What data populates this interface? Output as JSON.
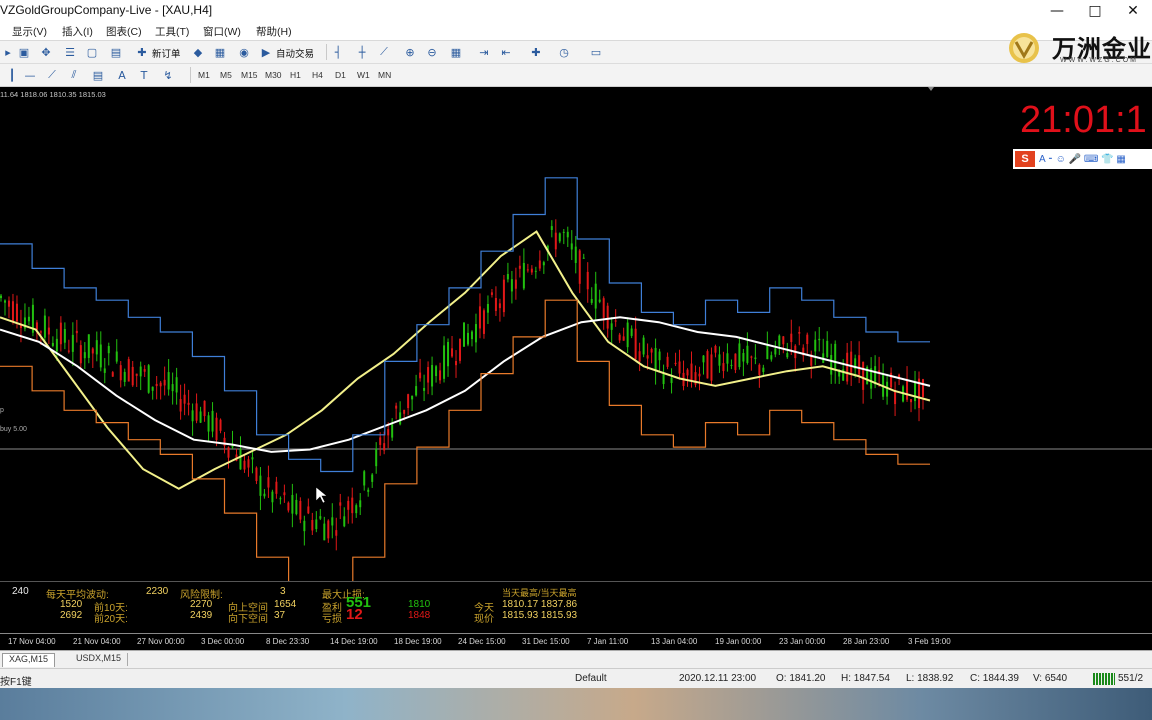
{
  "window": {
    "title": "VZGoldGroupCompany-Live - [XAU,H4]",
    "min": "—",
    "max": "□",
    "close": "✕"
  },
  "menu": [
    "显示(V)",
    "插入(I)",
    "图表(C)",
    "工具(T)",
    "窗口(W)",
    "帮助(H)"
  ],
  "toolbar": {
    "new_order": "新订单",
    "auto_trading": "自动交易"
  },
  "timeframes": [
    "M1",
    "M5",
    "M15",
    "M30",
    "H1",
    "H4",
    "D1",
    "W1",
    "MN"
  ],
  "logo": {
    "name": "万洲金业",
    "url": "WWW.WZG.COM"
  },
  "chart": {
    "ohlc_readout": "11.64 1818.06 1810.35 1815.03",
    "clock": "21:01:1",
    "side_label_p": "p",
    "side_label_buy": "buy 5.00",
    "ime_toolbar": "A ⁃ ☺ 🎤 ⌨ 👕 ▦"
  },
  "chart_data": {
    "type": "line",
    "symbol": "XAU",
    "timeframe": "H4",
    "x_ticks": [
      "17 Nov 04:00",
      "21 Nov 04:00",
      "27 Nov 00:00",
      "3 Dec 00:00",
      "8 Dec 23:30",
      "14 Dec 19:00",
      "18 Dec 19:00",
      "24 Dec 15:00",
      "31 Dec 15:00",
      "7 Jan 11:00",
      "13 Jan 04:00",
      "19 Jan 00:00",
      "23 Jan 00:00",
      "28 Jan 23:00",
      "3 Feb 19:00"
    ],
    "series": [
      {
        "values": [
          1878,
          1868,
          1860,
          1855,
          1848,
          1842,
          1832,
          1818,
          1800,
          1790,
          1785,
          1800,
          1830,
          1845,
          1860,
          1875,
          1890,
          1905,
          1880,
          1862,
          1850,
          1845,
          1855,
          1850,
          1860,
          1855,
          1848,
          1842,
          1838
        ]
      },
      {
        "values": [
          1870,
          1865,
          1845,
          1825,
          1808,
          1800,
          1808,
          1815,
          1822,
          1832,
          1845,
          1855,
          1868,
          1880,
          1895,
          1905,
          1880,
          1860,
          1850,
          1845,
          1842,
          1845,
          1848,
          1850,
          1846,
          1840,
          1836
        ]
      },
      {
        "values": [
          1865,
          1860,
          1850,
          1838,
          1828,
          1820,
          1818,
          1815,
          1816,
          1820,
          1826,
          1832,
          1840,
          1852,
          1862,
          1868,
          1870,
          1868,
          1864,
          1862,
          1858,
          1854,
          1850,
          1846,
          1842
        ]
      }
    ]
  },
  "info_panel": {
    "v240": "240",
    "lbl_daily": "每天平均波动:",
    "v2230": "2230",
    "lbl_risk": "风险限制:",
    "v3": "3",
    "lbl_max": "最大止损:",
    "lbl_lastday": "当天最高/当天最高",
    "v1520": "1520",
    "lbl_10d": "前10天:",
    "v2270": "2270",
    "lbl_up": "向上空间",
    "v1654": "1654",
    "lbl_win": "盈利",
    "v551": "551",
    "v1810": "1810",
    "lbl_today": "今天",
    "today_vals": "1810.17 1837.86",
    "v2692": "2692",
    "lbl_20d": "前20天:",
    "v2439": "2439",
    "lbl_down": "向下空间",
    "v37": "37",
    "lbl_loss": "亏损",
    "v12": "12",
    "v1848": "1848",
    "lbl_now": "现价",
    "now_vals": "1815.93 1815.93"
  },
  "tabs": [
    "XAG,M15",
    "USDX,M15"
  ],
  "status": {
    "help": "按F1键",
    "profile": "Default",
    "datetime": "2020.12.11 23:00",
    "open": "O: 1841.20",
    "high": "H: 1847.54",
    "low": "L: 1838.92",
    "close": "C: 1844.39",
    "volume": "V: 6540",
    "traffic": "551/2"
  },
  "colors": {
    "bull": "#22c00f",
    "bear": "#e11818",
    "ma_yellow": "#f2f08a",
    "ma_white": "#ffffff",
    "stop_blue": "#3f7fd8",
    "stop_orange": "#e87a2a",
    "clock": "#e0101a"
  }
}
